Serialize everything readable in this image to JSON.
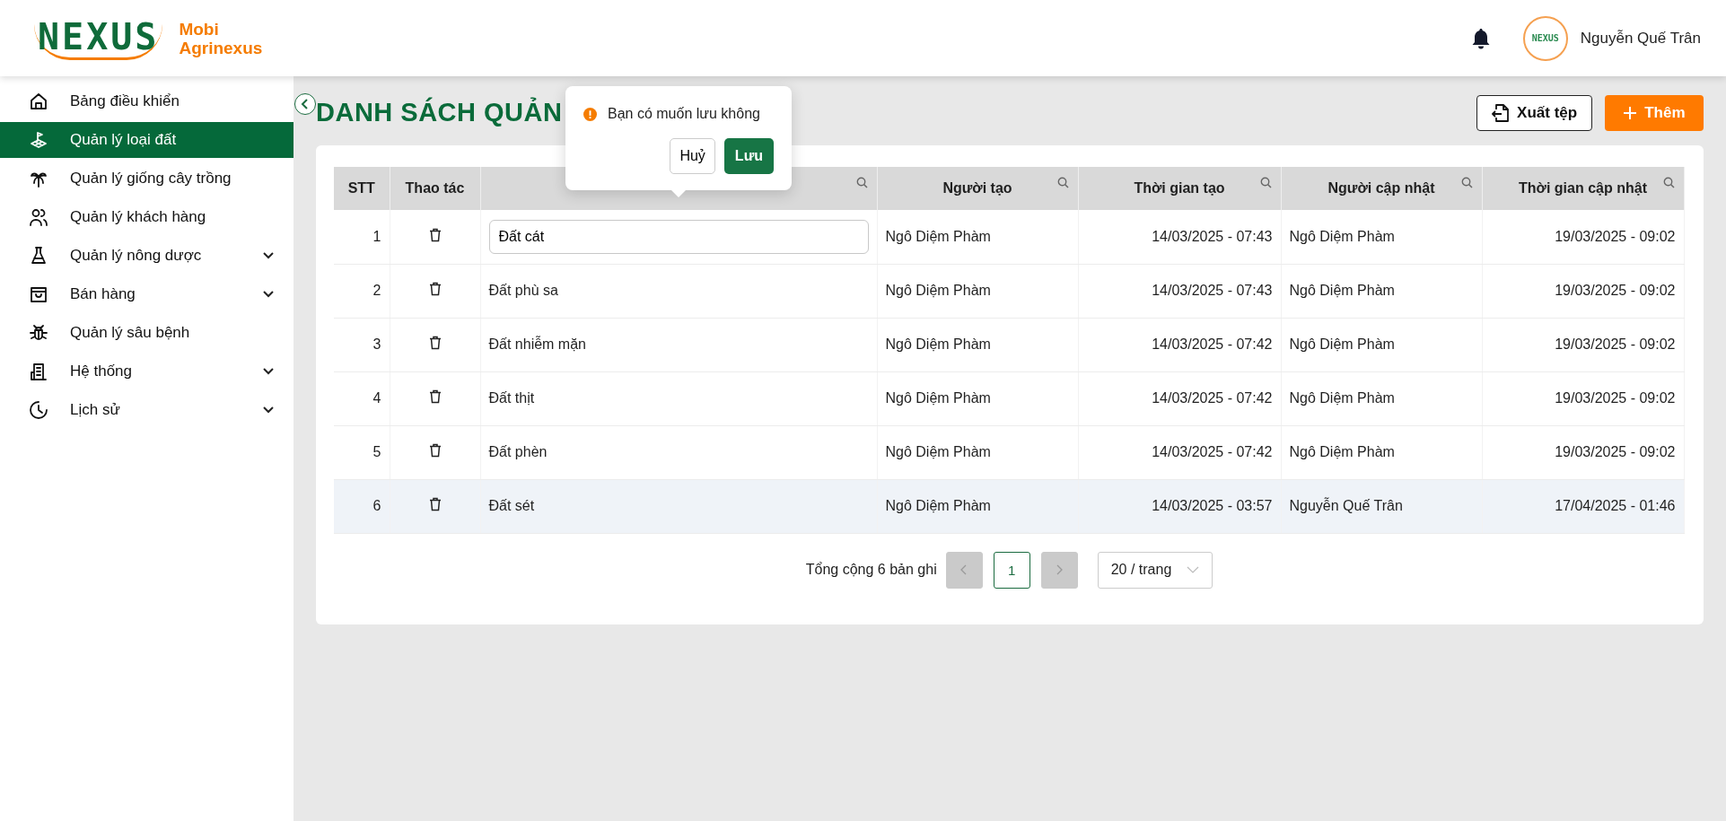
{
  "logo": {
    "mark": "NEXUS",
    "line1": "Mobi",
    "line2": "Agrinexus"
  },
  "header": {
    "user_name": "Nguyễn Quế Trân",
    "avatar_mark": "NEXUS"
  },
  "sidebar": {
    "items": [
      {
        "label": "Bảng điều khiển",
        "selected": false,
        "has_submenu": false
      },
      {
        "label": "Quản lý loại đất",
        "selected": true,
        "has_submenu": false
      },
      {
        "label": "Quản lý giống cây trồng",
        "selected": false,
        "has_submenu": false
      },
      {
        "label": "Quản lý khách hàng",
        "selected": false,
        "has_submenu": false
      },
      {
        "label": "Quản lý nông dược",
        "selected": false,
        "has_submenu": true
      },
      {
        "label": "Bán hàng",
        "selected": false,
        "has_submenu": true
      },
      {
        "label": "Quản lý sâu bệnh",
        "selected": false,
        "has_submenu": false
      },
      {
        "label": "Hệ thống",
        "selected": false,
        "has_submenu": true
      },
      {
        "label": "Lịch sử",
        "selected": false,
        "has_submenu": true
      }
    ]
  },
  "page": {
    "title": "DANH SÁCH QUẢN",
    "buttons": [
      {
        "kind": "export",
        "label": "Xuất tệp"
      },
      {
        "kind": "add",
        "label": "Thêm"
      }
    ]
  },
  "popconfirm": {
    "message": "Bạn có muốn lưu không",
    "cancel": "Huỷ",
    "confirm": "Lưu"
  },
  "table": {
    "columns": [
      {
        "label": "STT",
        "searchable": false
      },
      {
        "label": "Thao tác",
        "searchable": false
      },
      {
        "searchable": true
      },
      {
        "label": "Người tạo",
        "searchable": true
      },
      {
        "label": "Thời gian tạo",
        "searchable": true
      },
      {
        "label": "Người cập nhật",
        "searchable": true
      },
      {
        "label": "Thời gian cập nhật",
        "searchable": true
      }
    ],
    "rows": [
      {
        "stt": "1",
        "name": "Đất cát",
        "editing": true,
        "highlighted": false,
        "created_by": "Ngô Diệm Phàm",
        "created_at": "14/03/2025 - 07:43",
        "updated_by": "Ngô Diệm Phàm",
        "updated_at": "19/03/2025 - 09:02"
      },
      {
        "stt": "2",
        "name": "Đất phù sa",
        "editing": false,
        "highlighted": false,
        "created_by": "Ngô Diệm Phàm",
        "created_at": "14/03/2025 - 07:43",
        "updated_by": "Ngô Diệm Phàm",
        "updated_at": "19/03/2025 - 09:02"
      },
      {
        "stt": "3",
        "name": "Đất nhiễm mặn",
        "editing": false,
        "highlighted": false,
        "created_by": "Ngô Diệm Phàm",
        "created_at": "14/03/2025 - 07:42",
        "updated_by": "Ngô Diệm Phàm",
        "updated_at": "19/03/2025 - 09:02"
      },
      {
        "stt": "4",
        "name": "Đất thịt",
        "editing": false,
        "highlighted": false,
        "created_by": "Ngô Diệm Phàm",
        "created_at": "14/03/2025 - 07:42",
        "updated_by": "Ngô Diệm Phàm",
        "updated_at": "19/03/2025 - 09:02"
      },
      {
        "stt": "5",
        "name": "Đất phèn",
        "editing": false,
        "highlighted": false,
        "created_by": "Ngô Diệm Phàm",
        "created_at": "14/03/2025 - 07:42",
        "updated_by": "Ngô Diệm Phàm",
        "updated_at": "19/03/2025 - 09:02"
      },
      {
        "stt": "6",
        "name": "Đất sét",
        "editing": false,
        "highlighted": true,
        "created_by": "Ngô Diệm Phàm",
        "created_at": "14/03/2025 - 03:57",
        "updated_by": "Nguyễn Quế Trân",
        "updated_at": "17/04/2025 - 01:46"
      }
    ]
  },
  "pagination": {
    "total": "Tổng cộng 6 bản ghi",
    "prev_disabled": true,
    "next_disabled": true,
    "pages": [
      {
        "label": "1",
        "selected": true
      }
    ],
    "page_size": "20 / trang"
  }
}
